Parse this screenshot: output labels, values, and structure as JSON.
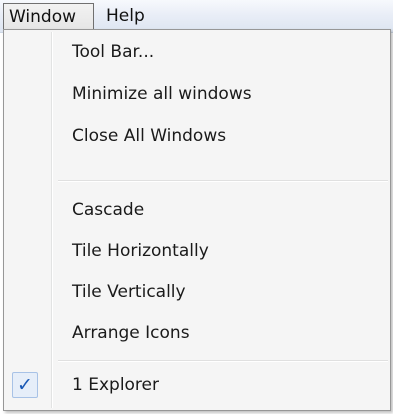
{
  "menubar": {
    "items": [
      {
        "label": "Window",
        "active": true
      },
      {
        "label": "Help",
        "active": false
      }
    ]
  },
  "dropdown": {
    "groups": [
      [
        {
          "label": "Tool Bar..."
        },
        {
          "label": "Minimize all windows"
        },
        {
          "label": "Close All Windows"
        }
      ],
      [
        {
          "label": "Cascade"
        },
        {
          "label": "Tile Horizontally"
        },
        {
          "label": "Tile Vertically"
        },
        {
          "label": "Arrange Icons"
        }
      ],
      [
        {
          "label": "1 Explorer",
          "checked": true,
          "check_glyph": "✓"
        }
      ]
    ]
  },
  "colors": {
    "check_accent": "#1a58b5",
    "menu_background": "#f5f5f5"
  }
}
